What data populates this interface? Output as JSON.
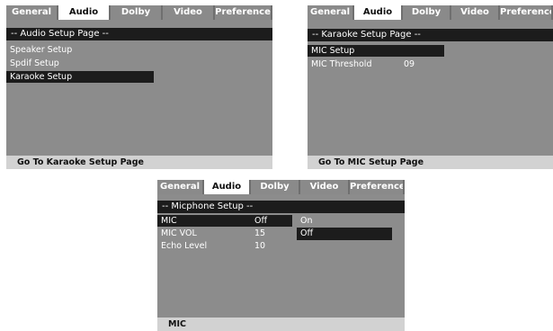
{
  "tabs": [
    "General",
    "Audio",
    "Dolby",
    "Video",
    "Preference"
  ],
  "screen1": {
    "active_tab": "Audio",
    "title": "-- Audio Setup Page --",
    "items": [
      "Speaker Setup",
      "Spdif Setup",
      "Karaoke Setup"
    ],
    "selected_item": "Karaoke Setup",
    "status": "Go To Karaoke Setup Page"
  },
  "screen2": {
    "active_tab": "Audio",
    "title": "-- Karaoke Setup Page --",
    "items": [
      {
        "label": "MIC Setup",
        "value": ""
      },
      {
        "label": "MIC Threshold",
        "value": "09"
      }
    ],
    "selected_item": "MIC Setup",
    "status": "Go To MIC Setup Page"
  },
  "screen3": {
    "active_tab": "Audio",
    "title": "-- Micphone Setup --",
    "items": [
      {
        "label": "MIC",
        "value": "Off"
      },
      {
        "label": "MIC VOL",
        "value": "15"
      },
      {
        "label": "Echo Level",
        "value": "10"
      }
    ],
    "selected_item": "MIC",
    "options": [
      "On",
      "Off"
    ],
    "selected_option": "Off",
    "status": "MIC"
  },
  "colors": {
    "panel": "#8c8c8c",
    "highlight": "#1c1c1c",
    "status_bar": "#d2d2d2",
    "active_tab": "#ffffff"
  }
}
